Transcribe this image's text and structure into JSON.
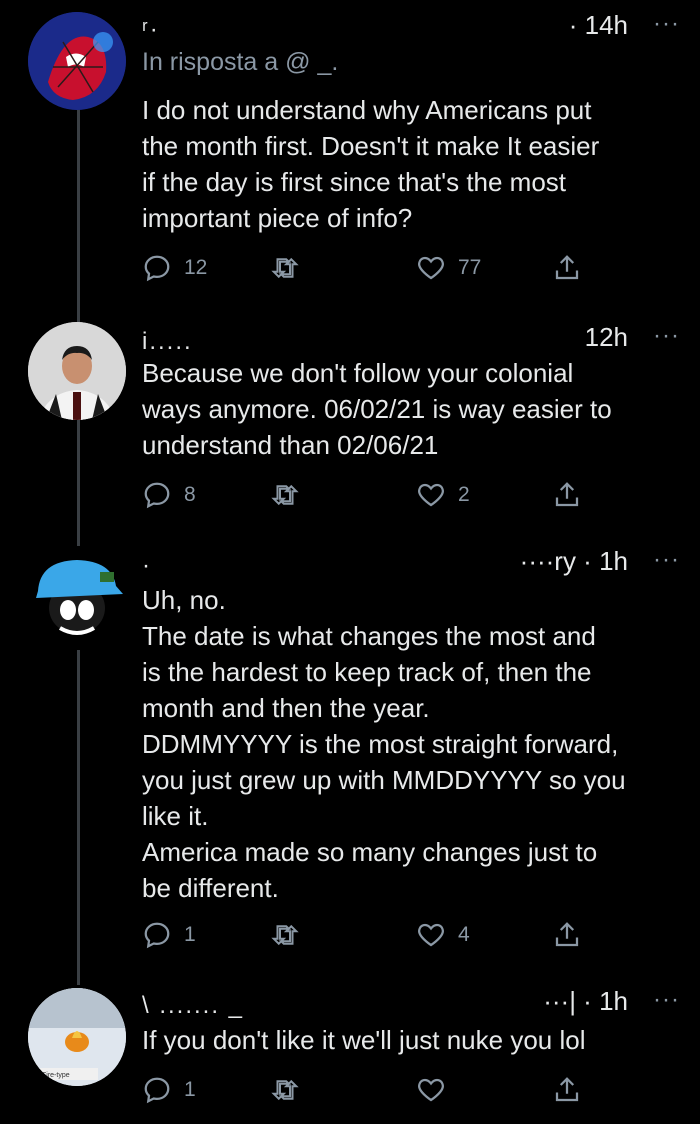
{
  "tweets": [
    {
      "author_redacted": "ʳ·",
      "time": "· 14h",
      "more": "···",
      "reply_to_prefix": "In risposta a @ _.",
      "body": "I do not understand why Americans put\nthe month first. Doesn't it make It easier\nif the day is first since that's the most\nimportant piece of info?",
      "replies": "12",
      "retweets": "",
      "likes": "77"
    },
    {
      "author_redacted": "i.....",
      "time": "12h",
      "more": "···",
      "body": "Because we don't follow your colonial\nways anymore. 06/02/21 is way easier to\nunderstand than 02/06/21",
      "replies": "8",
      "retweets": "",
      "likes": "2"
    },
    {
      "author_redacted": "·",
      "time": "····ry · 1h",
      "more": "···",
      "body": "Uh, no.\nThe date is what changes the most and\nis the hardest to keep track of, then the\nmonth and then the year.\nDDMMYYYY is the most straight forward,\nyou just grew up with MMDDYYYY so you\nlike it.\nAmerica made so many changes just to\nbe different.",
      "replies": "1",
      "retweets": "",
      "likes": "4"
    },
    {
      "author_redacted": "\\ ....... _",
      "time": "···| · 1h",
      "more": "···",
      "body": "If you don't like it we'll just nuke you lol",
      "replies": "1",
      "retweets": "",
      "likes": "",
      "avatar_caption": "Fire-type"
    }
  ],
  "colors": {
    "background": "#000000",
    "text": "#e7e9ea",
    "muted": "#8b98a5",
    "thread_line": "#3a3f44"
  }
}
